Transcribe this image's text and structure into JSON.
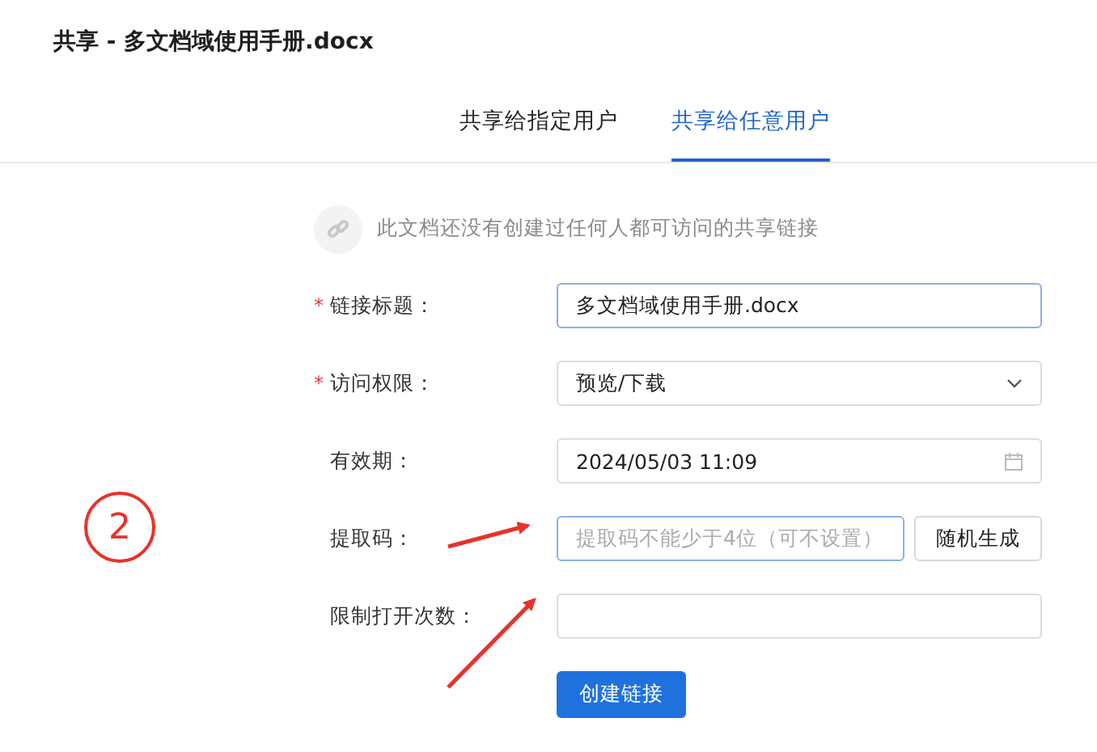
{
  "dialog": {
    "title": "共享 - 多文档域使用手册.docx"
  },
  "tabs": [
    {
      "label": "共享给指定用户",
      "selected": false
    },
    {
      "label": "共享给任意用户",
      "selected": true
    }
  ],
  "notice": "此文档还没有创建过任何人都可访问的共享链接",
  "form": {
    "fields": [
      {
        "kind": "text",
        "label": "链接标题：",
        "required_mark": "*",
        "value": "多文档域使用手册.docx",
        "focused": true
      },
      {
        "kind": "select",
        "label": "访问权限：",
        "required_mark": "*",
        "value": "预览/下载",
        "focused": false
      },
      {
        "kind": "date",
        "label": "有效期：",
        "value": "2024/05/03 11:09",
        "focused": false
      },
      {
        "kind": "text",
        "label": "提取码：",
        "placeholder": "提取码不能少于4位（可不设置）",
        "focused": true,
        "button": "随机生成"
      },
      {
        "kind": "text",
        "label": "限制打开次数：",
        "focused": false
      }
    ],
    "submit": "创建链接"
  },
  "annotation": {
    "step": "2"
  }
}
